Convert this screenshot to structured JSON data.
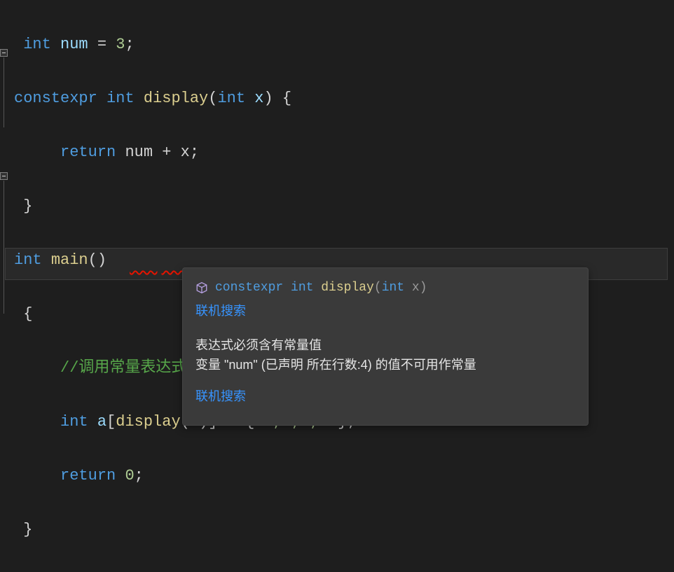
{
  "code": {
    "l1": {
      "type": "int",
      "var": "num",
      "eq": "=",
      "val": "3"
    },
    "l2": {
      "kw": "constexpr",
      "type": "int",
      "fn": "display",
      "ptype": "int",
      "p": "x"
    },
    "l3": {
      "kw": "return",
      "a": "num",
      "op": "+",
      "b": "x"
    },
    "l6": {
      "type": "int",
      "fn": "main"
    },
    "l8": "//调用常量表达式函数",
    "l9": {
      "type": "int",
      "var": "a",
      "fn": "display",
      "arg": "3",
      "init": "1,2,3,4"
    },
    "l10": {
      "kw": "return",
      "val": "0"
    }
  },
  "tooltip": {
    "icon": "cube-icon",
    "sig": {
      "kw": "constexpr",
      "type": "int",
      "fn": "display",
      "ptype": "int",
      "param": "x"
    },
    "link1": "联机搜索",
    "msg1": "表达式必须含有常量值",
    "msg2": "变量 \"num\" (已声明 所在行数:4) 的值不可用作常量",
    "link2": "联机搜索"
  },
  "chart_data": null
}
